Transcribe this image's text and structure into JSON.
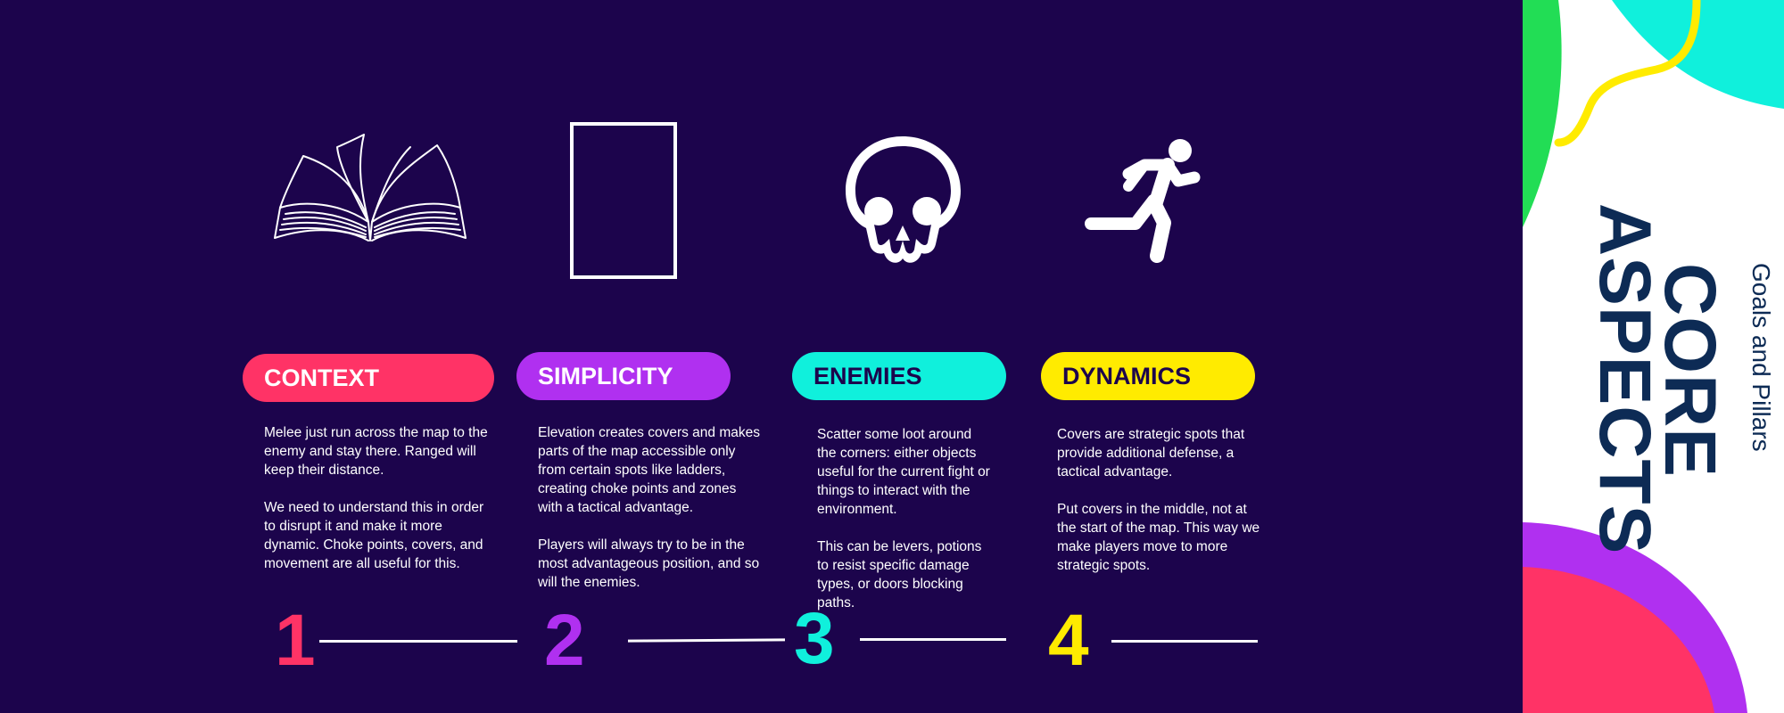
{
  "sidebar": {
    "subtitle": "Goals and Pillars",
    "title_line1": "CORE",
    "title_line2": "ASPECTS"
  },
  "colors": {
    "background": "#1c044c",
    "pink": "#ff3366",
    "purple": "#b030f0",
    "cyan": "#10f0dc",
    "yellow": "#ffeb00",
    "green": "#22dd55",
    "navy": "#0d2b55"
  },
  "pillars": [
    {
      "icon": "open-book-icon",
      "label": "CONTEXT",
      "number": "1",
      "description": "Melee just run across the map to the enemy and stay there. Ranged will keep their distance.\n\nWe need to understand this in order to disrupt it and make it more dynamic. Choke points, covers, and movement are all useful for this."
    },
    {
      "icon": "rectangle-frame-icon",
      "label": "SIMPLICITY",
      "number": "2",
      "description": "Elevation creates covers and makes parts of the map accessible only from certain spots like ladders, creating choke points and zones with a tactical advantage.\n\nPlayers will always try to be in the most advantageous position, and so will the enemies."
    },
    {
      "icon": "skull-icon",
      "label": "ENEMIES",
      "number": "3",
      "description": "Scatter some loot around the corners: either objects useful for the current fight or things to interact with the environment.\n\nThis can be levers, potions to resist specific damage types, or doors blocking paths."
    },
    {
      "icon": "running-person-icon",
      "label": "DYNAMICS",
      "number": "4",
      "description": "Covers are strategic spots that provide additional defense, a tactical advantage.\n\nPut covers in the middle, not at the start of the map. This way we make players move to more strategic spots."
    }
  ]
}
